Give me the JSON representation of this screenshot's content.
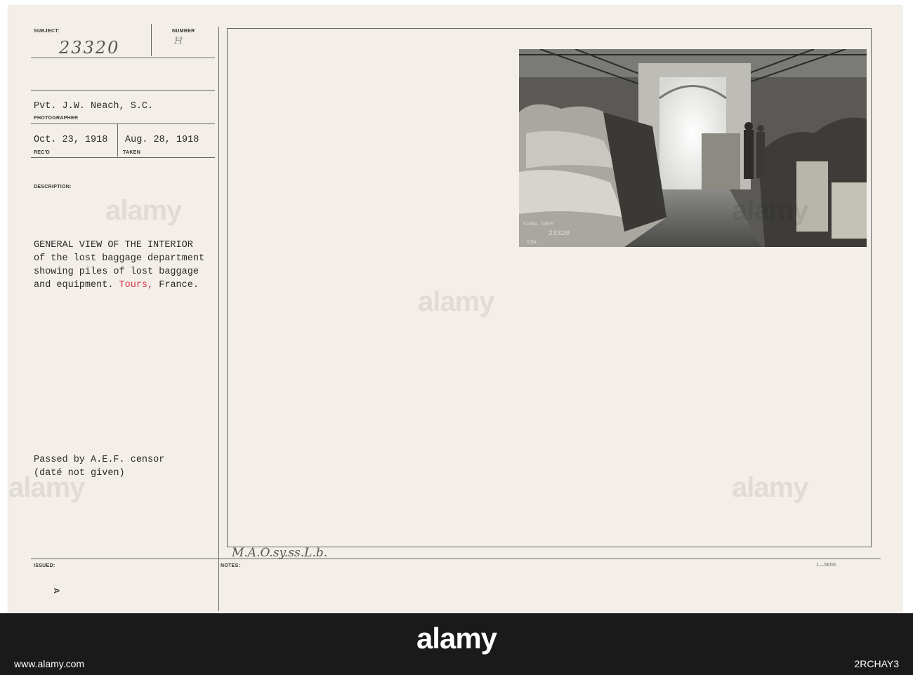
{
  "labels": {
    "subject": "SUBJECT:",
    "number": "NUMBER",
    "photographer": "PHOTOGRAPHER",
    "recd": "REC'D",
    "taken": "TAKEN",
    "description": "DESCRIPTION:",
    "issued": "ISSUED:",
    "notes": "NOTES:"
  },
  "subject_number": "23320",
  "photographer": "Pvt. J.W. Neach, S.C.",
  "date_received": "Oct. 23, 1918",
  "date_taken": "Aug. 28, 1918",
  "description": {
    "line1": "GENERAL VIEW OF THE INTERIOR",
    "line2": "of the lost baggage department",
    "line3": "showing piles of lost baggage",
    "line4_prefix": "and equipment.",
    "line4_place": "Tours,",
    "line4_country": "France."
  },
  "censor": {
    "line1": "Passed by A.E.F. censor",
    "line2": "(daté not given)"
  },
  "notes_handwritten": "M.A.O.sy.ss.L.b.",
  "issued_mark": "A",
  "form_code": "1—5606",
  "photo_stamp": {
    "agency": "SIGNAL CORPS",
    "country": "USA",
    "number": "23320"
  },
  "watermark": "alamy",
  "footer": {
    "logo": "alamy",
    "image_id": "2RCHAY3",
    "url": "www.alamy.com"
  }
}
